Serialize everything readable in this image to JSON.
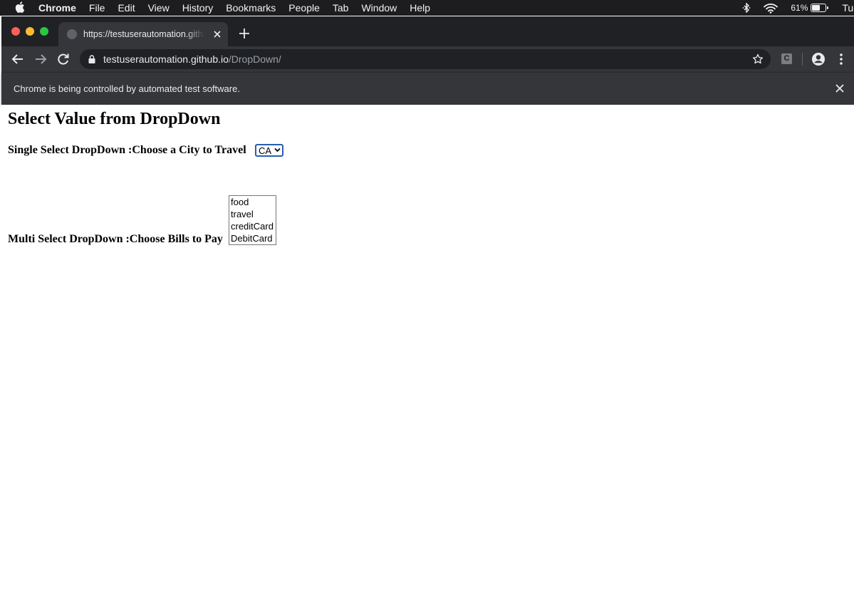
{
  "menubar": {
    "app_name": "Chrome",
    "items": [
      "File",
      "Edit",
      "View",
      "History",
      "Bookmarks",
      "People",
      "Tab",
      "Window",
      "Help"
    ],
    "battery": "61%",
    "clock": "Tue"
  },
  "browser": {
    "tab_title": "https://testuserautomation.github.io/DropDown/",
    "url_host": "testuserautomation.github.io",
    "url_path": "/DropDown/",
    "extension_label": "C",
    "infobar_message": "Chrome is being controlled by automated test software."
  },
  "page": {
    "heading": "Select Value from DropDown",
    "single_label": "Single Select DropDown :Choose a City to Travel",
    "single_value": "CA",
    "multi_label": "Multi Select DropDown :Choose Bills to Pay",
    "multi_options": [
      "food",
      "travel",
      "creditCard",
      "DebitCard"
    ]
  },
  "colors": {
    "menubar_bg": "#1d1d1f",
    "tabstrip_bg": "#202124",
    "toolbar_bg": "#35363a",
    "select_focus_border": "#2a5db0"
  }
}
